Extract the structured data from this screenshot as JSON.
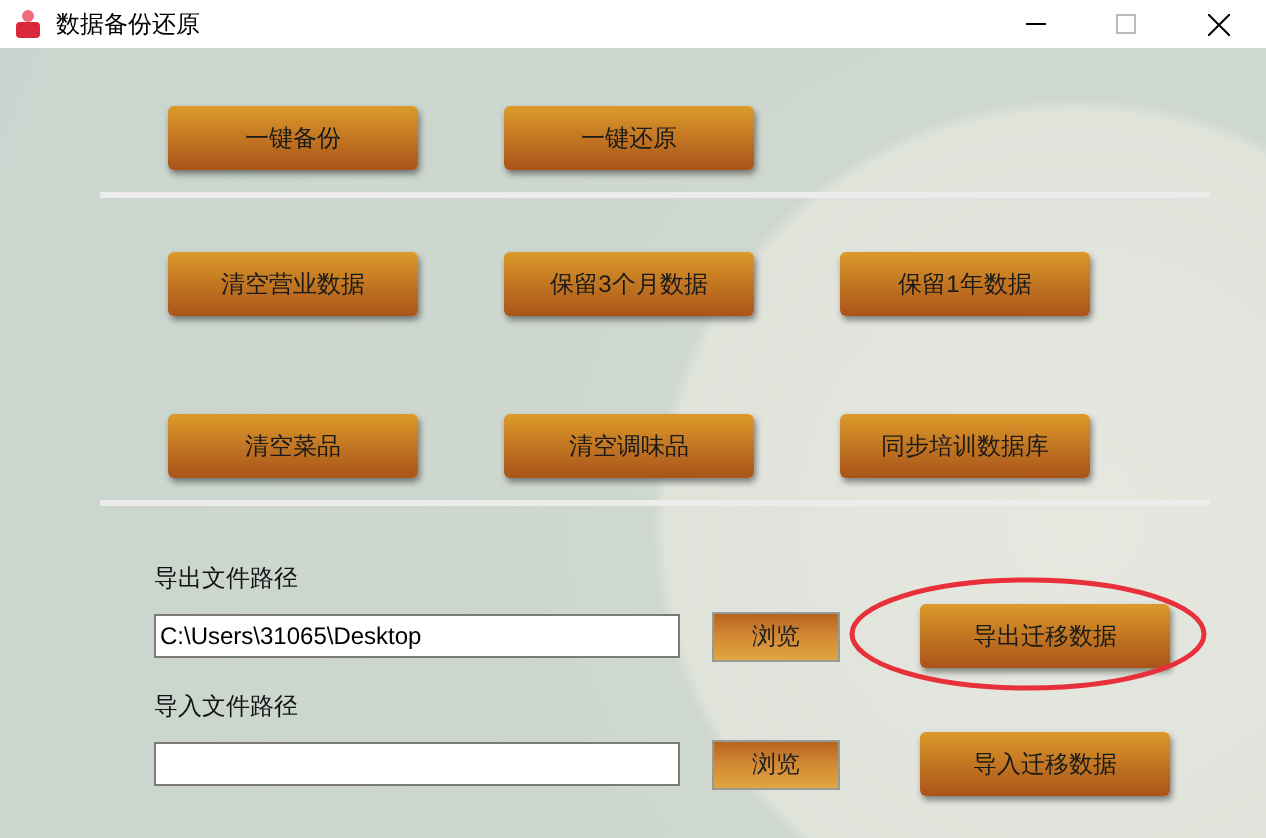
{
  "window": {
    "title": "数据备份还原"
  },
  "button_rows": [
    [
      "一键备份",
      "一键还原"
    ],
    [
      "清空营业数据",
      "保留3个月数据",
      "保留1年数据"
    ],
    [
      "清空菜品",
      "清空调味品",
      "同步培训数据库"
    ]
  ],
  "export": {
    "label": "导出文件路径",
    "value": "C:\\Users\\31065\\Desktop",
    "browse": "浏览",
    "action": "导出迁移数据",
    "circled": true
  },
  "import": {
    "label": "导入文件路径",
    "browse": "浏览",
    "action": "导入迁移数据"
  }
}
